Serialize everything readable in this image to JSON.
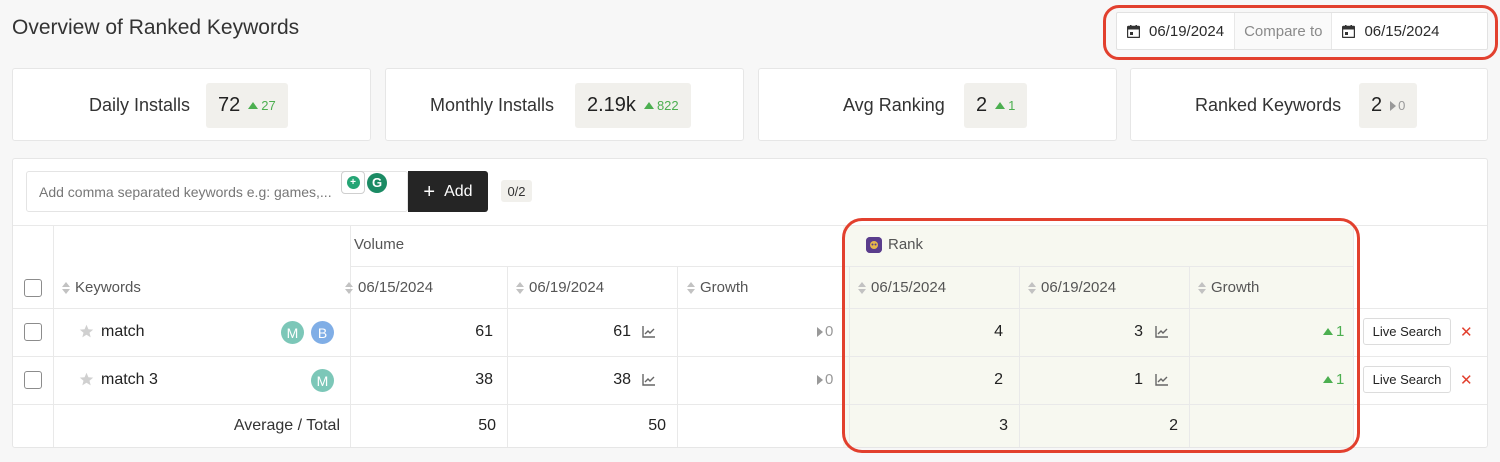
{
  "page": {
    "title": "Overview of Ranked Keywords"
  },
  "date_range": {
    "start": "06/19/2024",
    "compare_label": "Compare to",
    "compare": "06/15/2024"
  },
  "cards": [
    {
      "label": "Daily Installs",
      "value": "72",
      "delta": "27",
      "trend": "up"
    },
    {
      "label": "Monthly Installs",
      "value": "2.19k",
      "delta": "822",
      "trend": "up"
    },
    {
      "label": "Avg Ranking",
      "value": "2",
      "delta": "1",
      "trend": "up"
    },
    {
      "label": "Ranked Keywords",
      "value": "2",
      "delta": "0",
      "trend": "neutral"
    }
  ],
  "toolbar": {
    "input_placeholder": "Add comma separated keywords e.g: games,...",
    "add_label": "Add",
    "counter": "0/2"
  },
  "table": {
    "group_volume": "Volume",
    "group_rank": "Rank",
    "col_keywords": "Keywords",
    "col_vol_date1": "06/15/2024",
    "col_vol_date2": "06/19/2024",
    "col_vol_growth": "Growth",
    "col_rank_date1": "06/15/2024",
    "col_rank_date2": "06/19/2024",
    "col_rank_growth": "Growth",
    "rows": [
      {
        "keyword": "match",
        "avatars": [
          "M",
          "B"
        ],
        "vol_1": "61",
        "vol_2": "61",
        "vol_growth": "0",
        "rank_1": "4",
        "rank_2": "3",
        "rank_growth": "1",
        "action": "Live Search"
      },
      {
        "keyword": "match 3",
        "avatars": [
          "M"
        ],
        "vol_1": "38",
        "vol_2": "38",
        "vol_growth": "0",
        "rank_1": "2",
        "rank_2": "1",
        "rank_growth": "1",
        "action": "Live Search"
      }
    ],
    "footer": {
      "label": "Average / Total",
      "vol_1": "50",
      "vol_2": "50",
      "rank_1": "3",
      "rank_2": "2"
    }
  },
  "colors": {
    "positive": "#4caf50",
    "highlight": "#e2402e",
    "avatar_m": "#7cc7b8",
    "avatar_b": "#80aee6"
  }
}
